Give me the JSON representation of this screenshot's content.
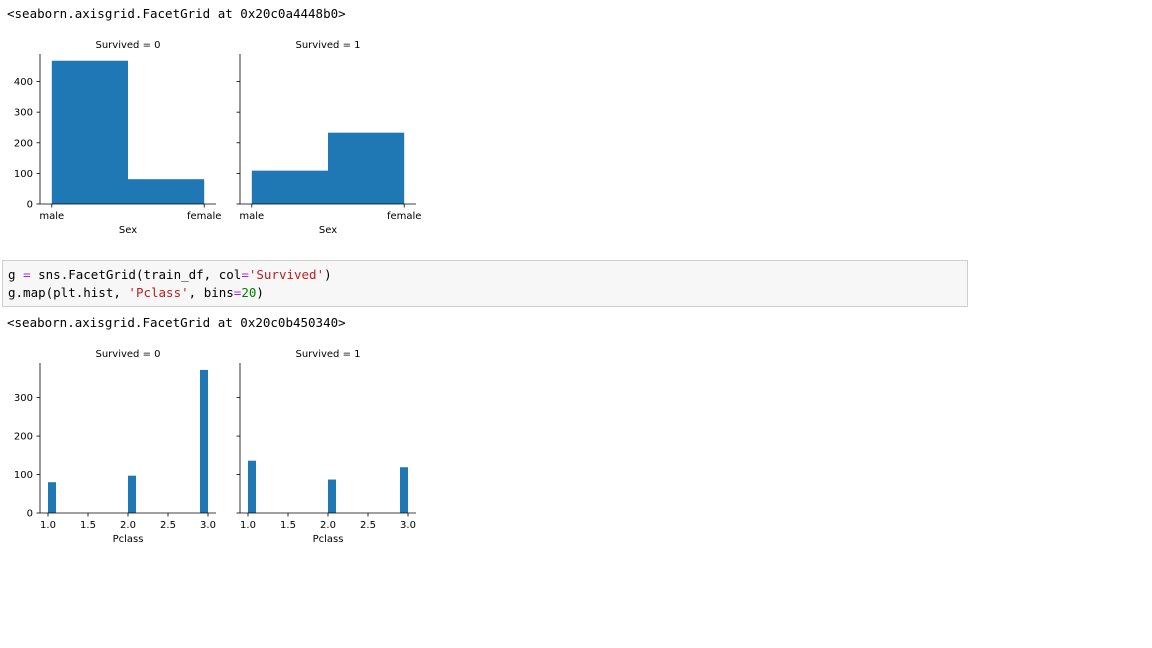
{
  "outputs": {
    "repr1": "<seaborn.axisgrid.FacetGrid at 0x20c0a4448b0>",
    "repr2": "<seaborn.axisgrid.FacetGrid at 0x20c0b450340>"
  },
  "code_cell": {
    "line1": {
      "a": "g ",
      "op": "=",
      "b": " sns.FacetGrid(train_df, col",
      "op2": "=",
      "str": "'Survived'",
      "c": ")"
    },
    "line2": {
      "a": "g.map(plt.hist, ",
      "str": "'Pclass'",
      "b": ", bins",
      "op": "=",
      "num": "20",
      "c": ")"
    }
  },
  "colors": {
    "bar": "#1f77b4",
    "axis": "#000000"
  },
  "chart_data": [
    {
      "type": "bar",
      "facet_title": "Survived = 0",
      "xlabel": "Sex",
      "categories": [
        "male",
        "female"
      ],
      "values": [
        468,
        81
      ],
      "ylim": [
        0,
        490
      ],
      "yticks": [
        0,
        100,
        200,
        300,
        400
      ],
      "grid": false
    },
    {
      "type": "bar",
      "facet_title": "Survived = 1",
      "xlabel": "Sex",
      "categories": [
        "male",
        "female"
      ],
      "values": [
        109,
        233
      ],
      "ylim": [
        0,
        490
      ],
      "yticks": [
        0,
        100,
        200,
        300,
        400
      ],
      "grid": false
    },
    {
      "type": "bar",
      "facet_title": "Survived = 0",
      "xlabel": "Pclass",
      "bins": [
        [
          1.0,
          1.1
        ],
        [
          2.0,
          2.1
        ],
        [
          2.9,
          3.0
        ]
      ],
      "values": [
        80,
        97,
        372
      ],
      "xlim": [
        0.9,
        3.1
      ],
      "xticks": [
        "1.0",
        "1.5",
        "2.0",
        "2.5",
        "3.0"
      ],
      "ylim": [
        0,
        390
      ],
      "yticks": [
        0,
        100,
        200,
        300
      ],
      "grid": false
    },
    {
      "type": "bar",
      "facet_title": "Survived = 1",
      "xlabel": "Pclass",
      "bins": [
        [
          1.0,
          1.1
        ],
        [
          2.0,
          2.1
        ],
        [
          2.9,
          3.0
        ]
      ],
      "values": [
        136,
        87,
        119
      ],
      "xlim": [
        0.9,
        3.1
      ],
      "xticks": [
        "1.0",
        "1.5",
        "2.0",
        "2.5",
        "3.0"
      ],
      "ylim": [
        0,
        390
      ],
      "yticks": [
        0,
        100,
        200,
        300
      ],
      "grid": false
    }
  ]
}
